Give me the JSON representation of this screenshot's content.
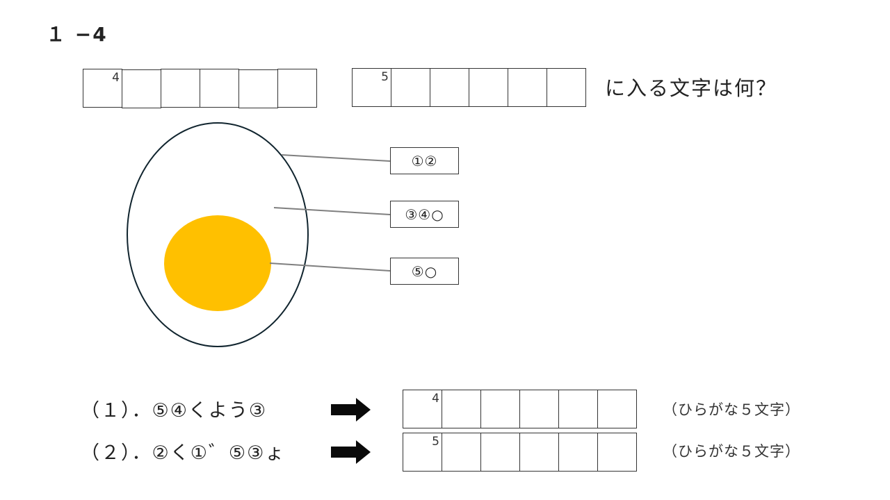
{
  "title": "１ −4",
  "question": {
    "box_a_number": "4",
    "box_b_number": "5",
    "text": "に入る文字は何？"
  },
  "diagram": {
    "yolk_color": "#FFC000",
    "labels": [
      "①②",
      "③④○",
      "⑤○"
    ]
  },
  "clues": [
    {
      "label": "（１）．⑤④くよう③",
      "answer_number": "4",
      "hint": "（ひらがな５文字）"
    },
    {
      "label": "（２）．②く①゛⑤③ょ",
      "answer_number": "5",
      "hint": "（ひらがな５文字）"
    }
  ]
}
